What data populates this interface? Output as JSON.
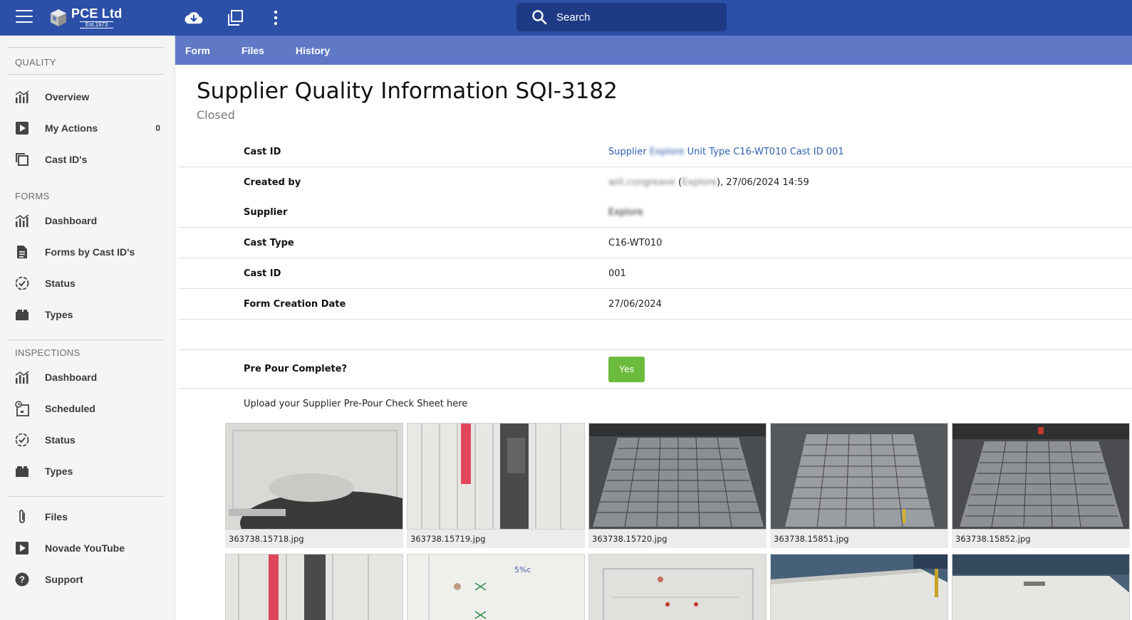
{
  "app": {
    "logo_name": "PCE Ltd",
    "logo_est": "Est.1973",
    "accent": "#2c4fa8",
    "tab_bar_color": "#6079c6"
  },
  "search": {
    "placeholder": "Search"
  },
  "toolbar": {
    "icons": [
      "cloud-download-icon",
      "copy-icon",
      "more-vert-icon"
    ]
  },
  "sidebar": {
    "sections": [
      {
        "heading": "QUALITY",
        "items": [
          {
            "label": "Overview",
            "icon": "bar-chart-icon"
          },
          {
            "label": "My Actions",
            "icon": "play-square-icon",
            "count": "0"
          },
          {
            "label": "Cast ID's",
            "icon": "copy-icon"
          }
        ]
      },
      {
        "heading": "FORMS",
        "items": [
          {
            "label": "Dashboard",
            "icon": "bar-chart-icon"
          },
          {
            "label": "Forms by Cast ID's",
            "icon": "document-icon"
          },
          {
            "label": "Status",
            "icon": "check-circle-icon"
          },
          {
            "label": "Types",
            "icon": "folder-icon"
          }
        ]
      },
      {
        "heading": "INSPECTIONS",
        "items": [
          {
            "label": "Dashboard",
            "icon": "bar-chart-icon"
          },
          {
            "label": "Scheduled",
            "icon": "calendar-clock-icon"
          },
          {
            "label": "Status",
            "icon": "check-circle-icon"
          },
          {
            "label": "Types",
            "icon": "folder-icon"
          }
        ]
      },
      {
        "heading": "",
        "items": [
          {
            "label": "Files",
            "icon": "paperclip-icon"
          },
          {
            "label": "Novade YouTube",
            "icon": "play-square-icon"
          },
          {
            "label": "Support",
            "icon": "help-circle-icon"
          }
        ]
      }
    ]
  },
  "tabs": [
    "Form",
    "Files",
    "History"
  ],
  "page": {
    "title": "Supplier Quality Information SQI-3182",
    "status": "Closed"
  },
  "fields": {
    "cast_id_link": {
      "label": "Cast ID",
      "pre": "Supplier ",
      "blurred": "Explore",
      "post": " Unit Type C16-WT010 Cast ID 001"
    },
    "created_by": {
      "label": "Created by",
      "user_blurred": "will.congreave",
      "open": " (",
      "org_blurred": "Explore",
      "close": "), ",
      "datetime": "27/06/2024 14:59"
    },
    "supplier": {
      "label": "Supplier",
      "value_blurred": "Explore"
    },
    "cast_type": {
      "label": "Cast Type",
      "value": "C16-WT010"
    },
    "cast_id": {
      "label": "Cast ID",
      "value": "001"
    },
    "form_creation_date": {
      "label": "Form Creation Date",
      "value": "27/06/2024"
    },
    "pre_pour": {
      "label": "Pre Pour Complete?",
      "value": "Yes"
    },
    "upload_label": "Upload your Supplier Pre-Pour Check Sheet here"
  },
  "gallery": {
    "row1": [
      {
        "caption": "363738.15718.jpg",
        "kind": "drawing"
      },
      {
        "caption": "363738.15719.jpg",
        "kind": "sheet"
      },
      {
        "caption": "363738.15720.jpg",
        "kind": "rebar"
      },
      {
        "caption": "363738.15851.jpg",
        "kind": "rebar"
      },
      {
        "caption": "363738.15852.jpg",
        "kind": "rebar"
      }
    ],
    "row2": [
      {
        "kind": "sheet"
      },
      {
        "kind": "paper"
      },
      {
        "kind": "drawing"
      },
      {
        "kind": "slab"
      },
      {
        "kind": "slab"
      }
    ]
  }
}
